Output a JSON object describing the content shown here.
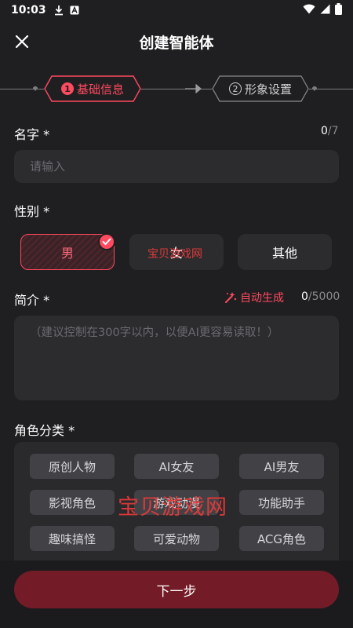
{
  "status_bar": {
    "time": "10:03",
    "icons": [
      "download-icon",
      "a-box-icon",
      "wifi-icon",
      "signal-icon",
      "battery-icon"
    ]
  },
  "header": {
    "title": "创建智能体",
    "close_icon": "close-icon"
  },
  "steps": [
    {
      "number": "1",
      "label": "基础信息",
      "active": true
    },
    {
      "number": "2",
      "label": "形象设置",
      "active": false
    }
  ],
  "name_field": {
    "label": "名字 *",
    "count": "0",
    "max": "/7",
    "placeholder": "请输入",
    "value": ""
  },
  "gender": {
    "label": "性别 *",
    "options": [
      "男",
      "女",
      "其他"
    ],
    "selected": "男"
  },
  "intro": {
    "label": "简介 *",
    "auto_generate": "自动生成",
    "count": "0",
    "max": "/5000",
    "placeholder": "（建议控制在300字以内，以便AI更容易读取！）",
    "value": ""
  },
  "category": {
    "label": "角色分类 *",
    "tags": [
      "原创人物",
      "AI女友",
      "AI男友",
      "影视角色",
      "游戏动漫",
      "功能助手",
      "趣味搞怪",
      "可爱动物",
      "ACG角色"
    ]
  },
  "next_button": "下一步",
  "watermark": "宝贝游戏网",
  "colors": {
    "background": "#1f1f21",
    "accent": "#ff4a5f",
    "button": "#731c27",
    "input": "#2c2c2f",
    "tag": "#424246"
  }
}
